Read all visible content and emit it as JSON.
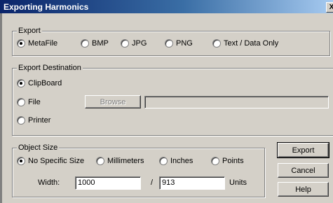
{
  "window": {
    "title": "Exporting Harmonics",
    "close_glyph": "X"
  },
  "export": {
    "legend": "Export",
    "options": [
      {
        "label": "MetaFile",
        "selected": true
      },
      {
        "label": "BMP",
        "selected": false
      },
      {
        "label": "JPG",
        "selected": false
      },
      {
        "label": "PNG",
        "selected": false
      },
      {
        "label": "Text / Data Only",
        "selected": false
      }
    ]
  },
  "destination": {
    "legend": "Export Destination",
    "options": [
      {
        "label": "ClipBoard",
        "selected": true
      },
      {
        "label": "File",
        "selected": false
      },
      {
        "label": "Printer",
        "selected": false
      }
    ],
    "browse_label": "Browse",
    "file_path": ""
  },
  "object_size": {
    "legend": "Object Size",
    "options": [
      {
        "label": "No Specific Size",
        "selected": true
      },
      {
        "label": "Millimeters",
        "selected": false
      },
      {
        "label": "Inches",
        "selected": false
      },
      {
        "label": "Points",
        "selected": false
      }
    ],
    "width_label": "Width:",
    "width_value": "1000",
    "separator": "/",
    "height_value": "913",
    "units_label": "Units"
  },
  "buttons": {
    "export": "Export",
    "cancel": "Cancel",
    "help": "Help"
  }
}
